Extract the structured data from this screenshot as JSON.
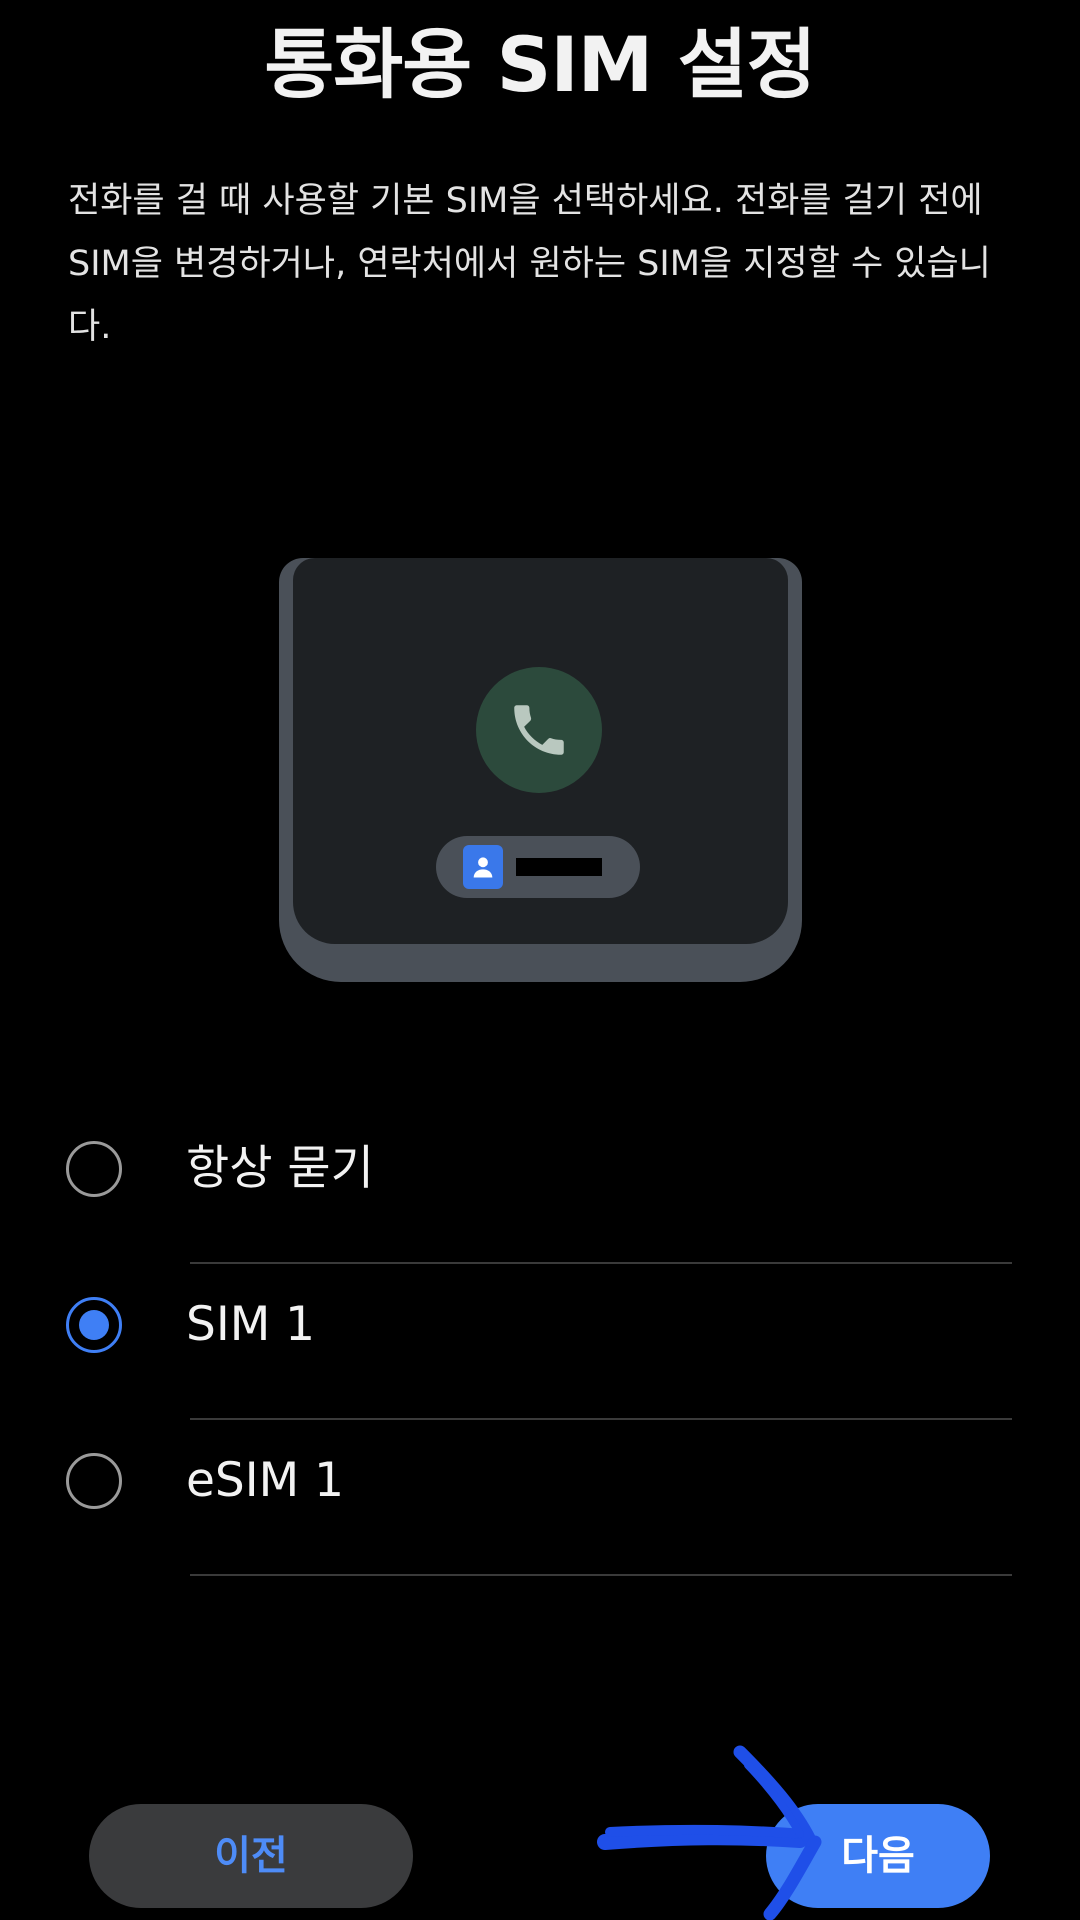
{
  "page": {
    "title": "통화용 SIM 설정",
    "description": "전화를 걸 때 사용할 기본 SIM을 선택하세요. 전화를 걸기 전에 SIM을 변경하거나, 연락처에서 원하는 SIM을 지정할 수 있습니다."
  },
  "illustration": {
    "icon": "phone-icon",
    "contact_icon": "contact-card-icon"
  },
  "options": [
    {
      "label": "항상 묻기",
      "selected": false
    },
    {
      "label": "SIM 1",
      "selected": true
    },
    {
      "label": "eSIM 1",
      "selected": false
    }
  ],
  "buttons": {
    "prev_label": "이전",
    "next_label": "다음"
  },
  "colors": {
    "accent": "#3f7ff5",
    "background": "#000000",
    "annotation": "#1f4fe8"
  }
}
